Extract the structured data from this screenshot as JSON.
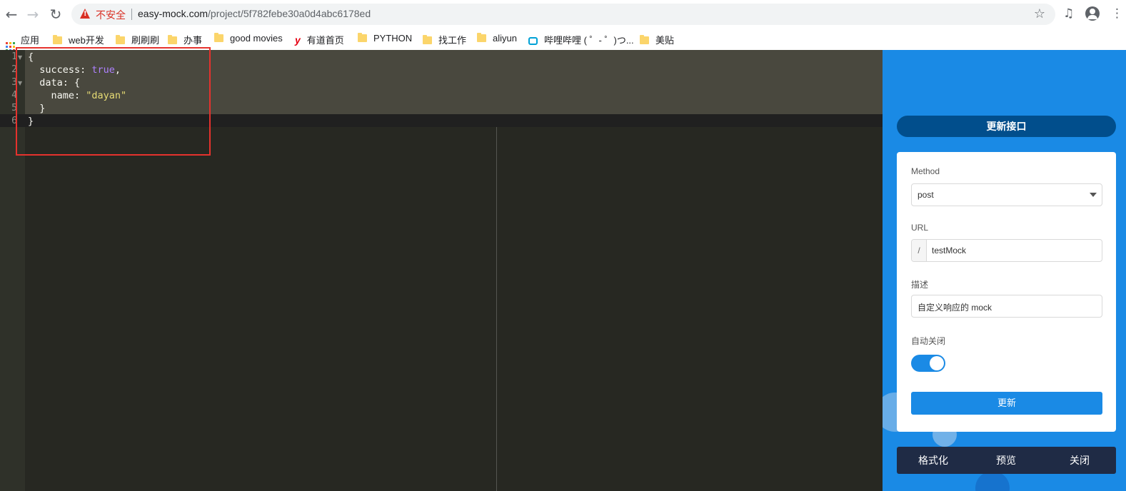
{
  "browser": {
    "insecure_label": "不安全",
    "url_host": "easy-mock.com",
    "url_path": "/project/5f782febe30a0d4abc6178ed",
    "bookmarks": [
      {
        "label": "应用",
        "icon": "apps-icon"
      },
      {
        "label": "web开发",
        "icon": "folder-icon"
      },
      {
        "label": "刷刷刷",
        "icon": "folder-icon"
      },
      {
        "label": "办事",
        "icon": "folder-icon"
      },
      {
        "label": "good movies",
        "icon": "folder-icon"
      },
      {
        "label": "有道首页",
        "icon": "youdao-icon"
      },
      {
        "label": "PYTHON",
        "icon": "folder-icon"
      },
      {
        "label": "找工作",
        "icon": "folder-icon"
      },
      {
        "label": "aliyun",
        "icon": "folder-icon"
      },
      {
        "label": "哔哩哔哩 ( ゜- ゜)つ...",
        "icon": "bilibili-icon"
      },
      {
        "label": "美贴",
        "icon": "folder-icon"
      }
    ]
  },
  "editor": {
    "line_numbers": [
      "1",
      "2",
      "3",
      "4",
      "5",
      "6"
    ],
    "lines": {
      "l1": "{",
      "l2_key": "  success: ",
      "l2_val": "true",
      "l2_end": ",",
      "l3": "  data: {",
      "l4_key": "    name: ",
      "l4_val": "\"dayan\"",
      "l5": "  }",
      "l6": "}"
    },
    "highlight_color": "#e5322d"
  },
  "panel": {
    "title": "更新接口",
    "method_label": "Method",
    "method_value": "post",
    "url_label": "URL",
    "url_prefix": "/",
    "url_value": "testMock",
    "desc_label": "描述",
    "desc_value": "自定义响应的 mock",
    "auto_close_label": "自动关闭",
    "auto_close_on": true,
    "update_button": "更新",
    "actions": {
      "format": "格式化",
      "preview": "预览",
      "close": "关闭"
    },
    "accent_color": "#1a8ae5"
  }
}
